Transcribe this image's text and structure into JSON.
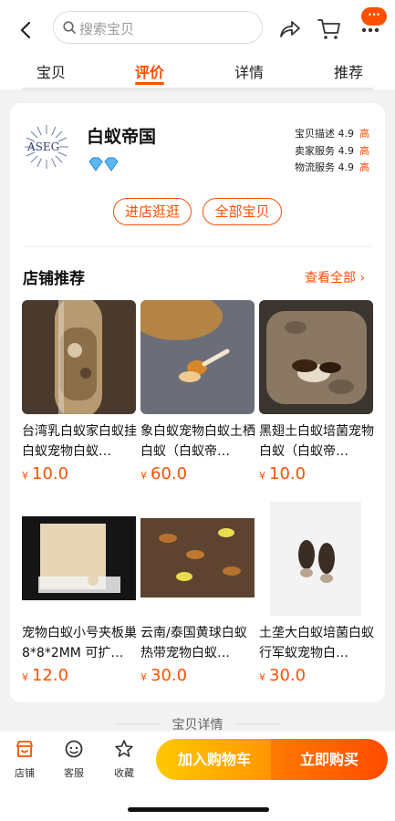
{
  "header": {
    "search_placeholder": "搜索宝贝",
    "more_badge": "···"
  },
  "tabs": [
    {
      "label": "宝贝",
      "active": false
    },
    {
      "label": "评价",
      "active": true
    },
    {
      "label": "详情",
      "active": false
    },
    {
      "label": "推荐",
      "active": false
    }
  ],
  "store": {
    "name": "白蚁帝国",
    "logo_text": "ASEG",
    "ratings": [
      {
        "label": "宝贝描述",
        "score": "4.9",
        "level": "高"
      },
      {
        "label": "卖家服务",
        "score": "4.9",
        "level": "高"
      },
      {
        "label": "物流服务",
        "score": "4.9",
        "level": "高"
      }
    ],
    "enter_store_label": "进店逛逛",
    "all_items_label": "全部宝贝"
  },
  "recommend": {
    "title": "店铺推荐",
    "view_all_label": "查看全部 ›",
    "currency": "¥",
    "products": [
      {
        "name": "台湾乳白蚁家白蚁挂白蚁宠物白蚁…",
        "price": "10.0"
      },
      {
        "name": "象白蚁宠物白蚁土栖白蚁（白蚁帝…",
        "price": "60.0"
      },
      {
        "name": "黑翅土白蚁培菌宠物白蚁（白蚁帝…",
        "price": "10.0"
      },
      {
        "name": "宠物白蚁小号夹板巢 8*8*2MM 可扩…",
        "price": "12.0"
      },
      {
        "name": "云南/泰国黄球白蚁热带宠物白蚁…",
        "price": "30.0"
      },
      {
        "name": "土垄大白蚁培菌白蚁行军蚁宠物白…",
        "price": "30.0"
      }
    ]
  },
  "detail_label": "宝贝详情",
  "bottom": {
    "store_label": "店铺",
    "service_label": "客服",
    "favorite_label": "收藏",
    "add_to_cart_label": "加入购物车",
    "buy_now_label": "立即购买"
  },
  "colors": {
    "accent": "#ff5000",
    "cart_gradient_start": "#ffc800",
    "buy_gradient_end": "#ff4b00"
  }
}
